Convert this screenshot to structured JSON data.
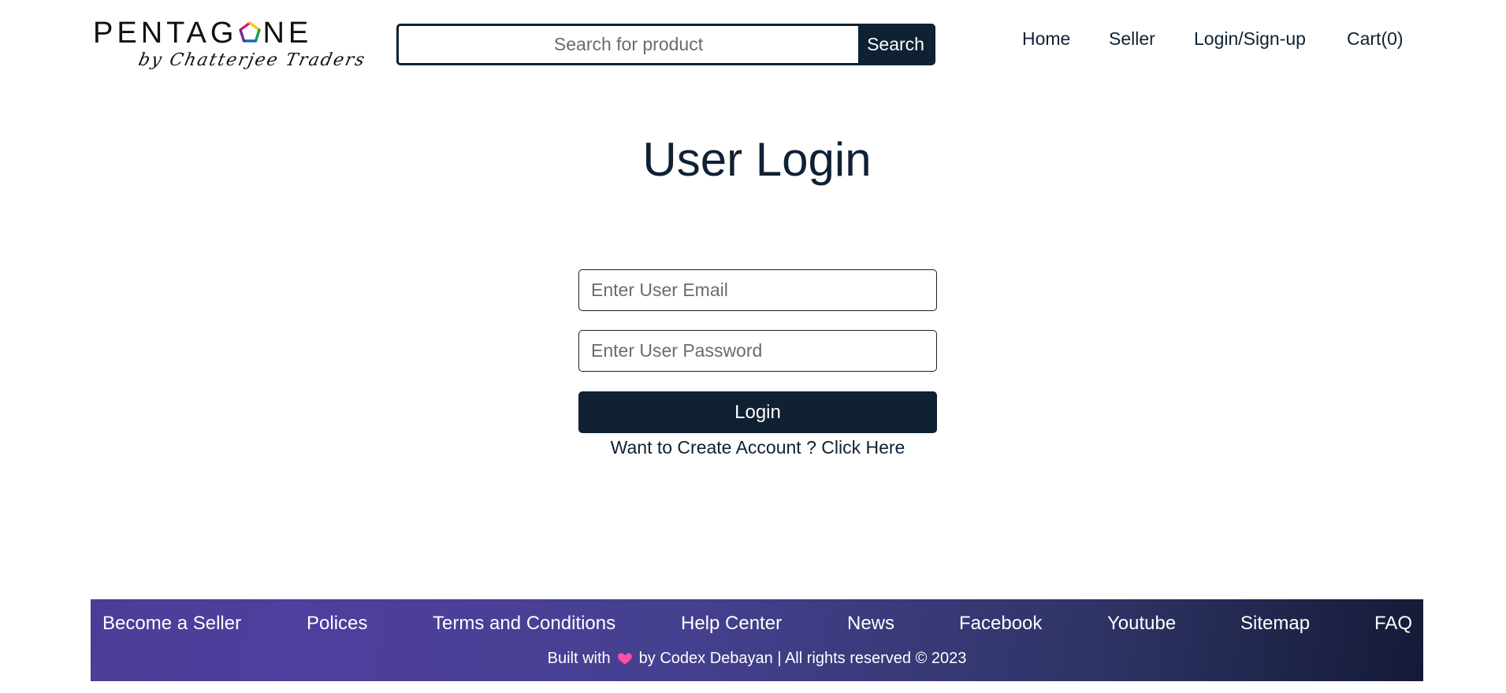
{
  "brand": {
    "logo_text": "PENTAGONE",
    "logo_text_before_icon": "PENTAG",
    "logo_text_after_icon": "NE",
    "logo_subtitle": "by Chatterjee Traders",
    "logo_icon": "pentagon-icon",
    "logo_icon_colors": [
      "#e6007e",
      "#ffcc00",
      "#00a651",
      "#0072bc",
      "#662d91"
    ]
  },
  "search": {
    "placeholder": "Search for product",
    "value": "",
    "button_label": "Search"
  },
  "nav": {
    "items": [
      {
        "label": "Home"
      },
      {
        "label": "Seller"
      },
      {
        "label": "Login/Sign-up"
      },
      {
        "label": "Cart(0)"
      }
    ]
  },
  "login": {
    "title": "User Login",
    "email_placeholder": "Enter User Email",
    "email_value": "",
    "password_placeholder": "Enter User Password",
    "password_value": "",
    "button_label": "Login",
    "create_prompt": "Want to Create Account ? ",
    "create_link": "Click Here"
  },
  "footer": {
    "links": [
      {
        "label": "Become a Seller"
      },
      {
        "label": "Polices"
      },
      {
        "label": "Terms and Conditions"
      },
      {
        "label": "Help Center"
      },
      {
        "label": "News"
      },
      {
        "label": "Facebook"
      },
      {
        "label": "Youtube"
      },
      {
        "label": "Sitemap"
      },
      {
        "label": "FAQ"
      }
    ],
    "built_with": "Built with",
    "heart_icon": "heart-icon",
    "heart_color": "#ff4fa3",
    "credit": "by Codex Debayan | All rights reserved © 2023"
  },
  "colors": {
    "primary": "#0f2133",
    "footer_gradient_start": "#4b3d97",
    "footer_gradient_end": "#141a36"
  }
}
